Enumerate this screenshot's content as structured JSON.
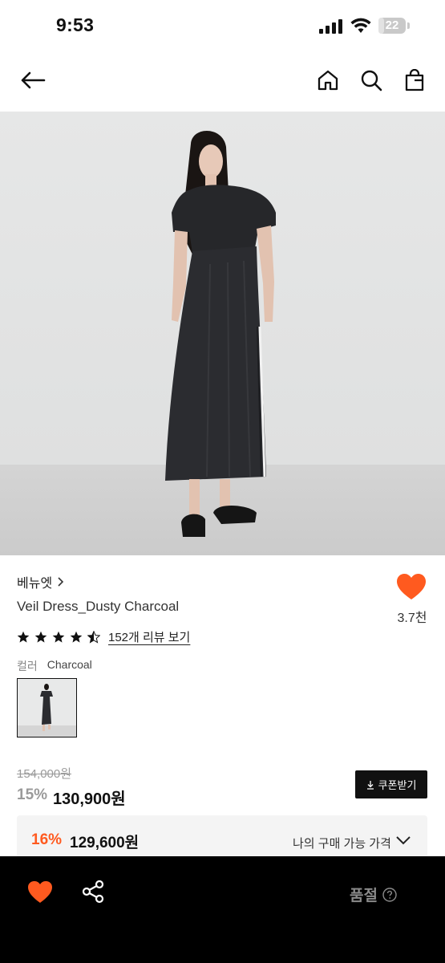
{
  "status_bar": {
    "time": "9:53",
    "battery": "22",
    "battery_level": 0.22
  },
  "nav": {
    "back_icon": "arrow-left-icon",
    "home_icon": "home-icon",
    "search_icon": "search-icon",
    "bag_icon": "shopping-bag-icon"
  },
  "product": {
    "brand": "베뉴엣",
    "name": "Veil Dress_Dusty Charcoal",
    "wish_count": "3.7천",
    "rating": 4.5,
    "review_link": "152개 리뷰 보기",
    "color_label": "컬러",
    "color_value": "Charcoal"
  },
  "price": {
    "original": "154,000원",
    "discount_rate": "15%",
    "sale": "130,900원",
    "coupon_button": "쿠폰받기",
    "my_discount_rate": "16%",
    "my_price": "129,600원",
    "my_price_label": "나의 구매 가능 가격"
  },
  "bottom_bar": {
    "status": "품절"
  },
  "colors": {
    "accent": "#ff5a1f",
    "heart": "#ff5a1f",
    "dark": "#111111",
    "bottom_bar": "#000000"
  }
}
